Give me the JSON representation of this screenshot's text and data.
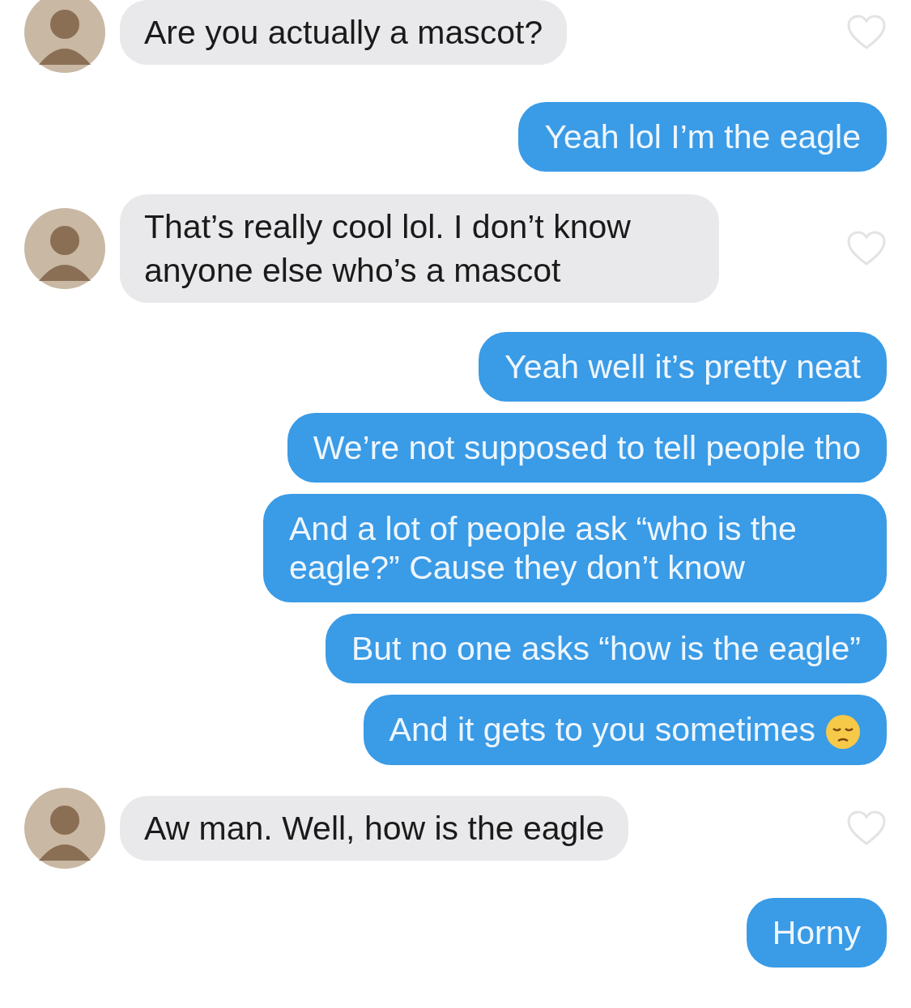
{
  "messages": [
    {
      "kind": "received",
      "text": "Are you actually a mascot?"
    },
    {
      "kind": "sent",
      "text": "Yeah lol I’m the eagle"
    },
    {
      "kind": "received",
      "text": "That’s really cool lol. I don’t know anyone else who’s a mascot"
    },
    {
      "kind": "sent",
      "text": "Yeah well it’s pretty neat"
    },
    {
      "kind": "sent",
      "text": "We’re not supposed to tell people tho"
    },
    {
      "kind": "sent",
      "text": "And a lot of people ask “who is the eagle?” Cause they don’t know"
    },
    {
      "kind": "sent",
      "text": "But no one asks “how is the eagle”"
    },
    {
      "kind": "sent",
      "text": "And it gets to you sometimes",
      "emoji": true
    },
    {
      "kind": "received",
      "text": "Aw man. Well, how is the eagle"
    },
    {
      "kind": "sent",
      "text": "Horny"
    }
  ]
}
